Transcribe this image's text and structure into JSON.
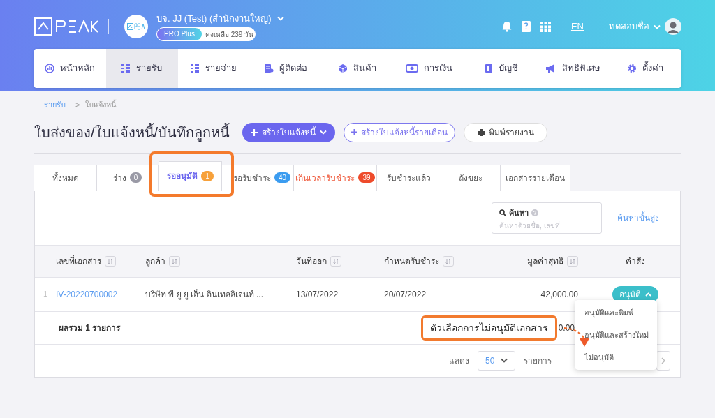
{
  "header": {
    "company": "บจ. JJ (Test) (สำนักงานใหญ่)",
    "plan": "PRO Plus",
    "remaining": "คงเหลือ 239 วัน",
    "language": "EN",
    "user": "ทดสอบชื่อ"
  },
  "nav": [
    {
      "label": "หน้าหลัก",
      "selected": false
    },
    {
      "label": "รายรับ",
      "selected": true
    },
    {
      "label": "รายจ่าย",
      "selected": false
    },
    {
      "label": "ผู้ติดต่อ",
      "selected": false
    },
    {
      "label": "สินค้า",
      "selected": false
    },
    {
      "label": "การเงิน",
      "selected": false
    },
    {
      "label": "บัญชี",
      "selected": false
    },
    {
      "label": "สิทธิพิเศษ",
      "selected": false
    },
    {
      "label": "ตั้งค่า",
      "selected": false
    }
  ],
  "breadcrumb": [
    "รายรับ",
    ">",
    "ใบแจ้งหนี้"
  ],
  "title": "ใบส่งของ/ใบแจ้งหนี้/บันทึกลูกหนี้",
  "actions": [
    {
      "kind": "primary",
      "label": "สร้างใบแจ้งหนี้"
    },
    {
      "kind": "outline",
      "label": "สร้างใบแจ้งหนี้รายเดือน"
    },
    {
      "kind": "print",
      "label": "พิมพ์รายงาน"
    }
  ],
  "tabs": [
    {
      "label": "ทั้งหมด",
      "overdue": false,
      "selected": false
    },
    {
      "label": "ร่าง",
      "count": "0",
      "color": "#9a9aa6",
      "overdue": false,
      "selected": false
    },
    {
      "label": "รออนุมัติ",
      "count": "1",
      "color": "#f7a13a",
      "overdue": false,
      "selected": true
    },
    {
      "label": "รอรับชำระ",
      "count": "40",
      "color": "#3b9cf0",
      "overdue": false,
      "selected": false
    },
    {
      "label": "เกินเวลารับชำระ",
      "count": "39",
      "color": "#ee4b2b",
      "overdue": true,
      "selected": false
    },
    {
      "label": "รับชำระแล้ว",
      "overdue": false,
      "selected": false
    },
    {
      "label": "ถังขยะ",
      "overdue": false,
      "selected": false
    },
    {
      "label": "เอกสารรายเดือน",
      "overdue": false,
      "selected": false
    }
  ],
  "search": {
    "label": "ค้นหา",
    "placeholder": "ค้นหาด้วยชื่อ, เลขที่",
    "advanced": "ค้นหาขั้นสูง"
  },
  "table": {
    "columns": [
      "เลขที่เอกสาร",
      "ลูกค้า",
      "วันที่ออก",
      "กำหนดรับชำระ",
      "มูลค่าสุทธิ",
      "คำสั่ง"
    ],
    "rows": [
      {
        "index": "1",
        "doc": "IV-20220700002",
        "customer": "บริษัท พี ยู ยู เอ็น อินเทลลิเจนท์ ...",
        "issued": "13/07/2022",
        "due": "20/07/2022",
        "amount": "42,000.00",
        "action": "อนุมัติ"
      }
    ],
    "total_label": "ผลรวม 1 รายการ",
    "total_amount": "0.00"
  },
  "menu": [
    "อนุมัติและพิมพ์",
    "อนุมัติและสร้างใหม่",
    "ไม่อนุมัติ"
  ],
  "pagination": {
    "show": "แสดง",
    "per_page": "50",
    "unit": "รายการ"
  },
  "callout": {
    "text": "ตัวเลือกการไม่อนุมัติเอกสาร"
  }
}
